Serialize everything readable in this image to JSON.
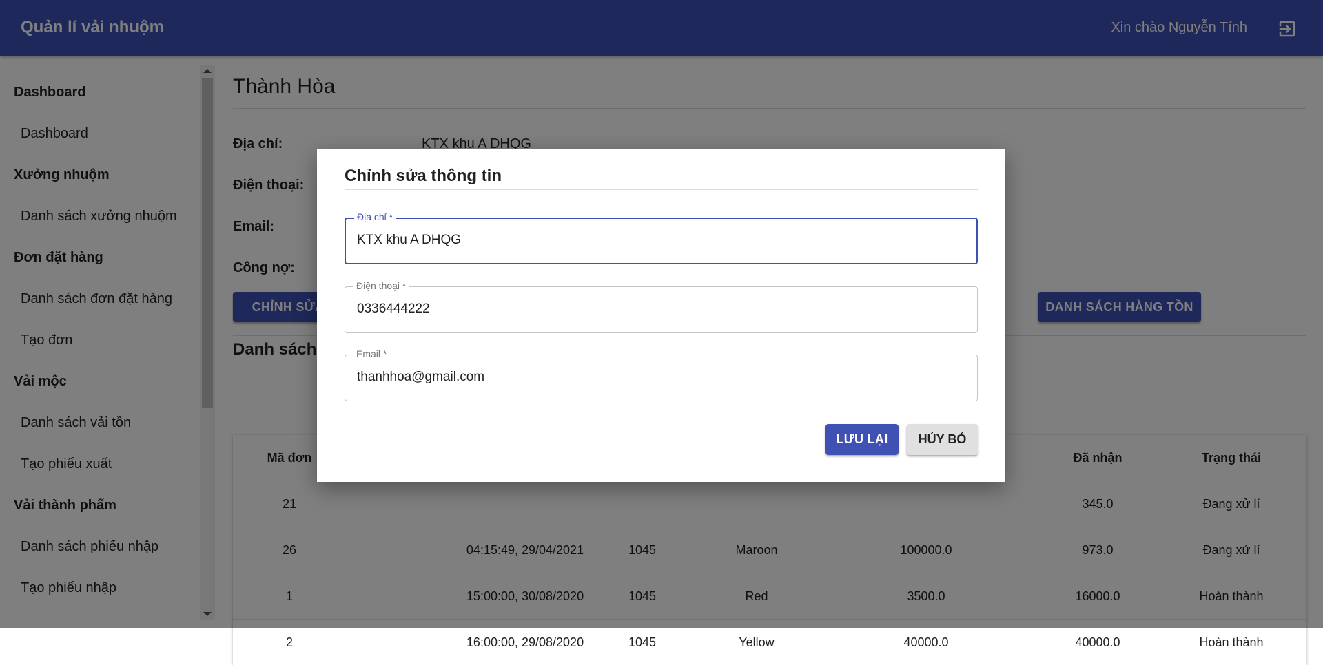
{
  "app": {
    "title": "Quản lí vải nhuộm",
    "greeting": "Xin chào Nguyễn Tính",
    "logout_icon": "logout-icon"
  },
  "sidebar": {
    "groups": [
      {
        "label": "Dashboard",
        "items": [
          "Dashboard"
        ]
      },
      {
        "label": "Xưởng nhuộm",
        "items": [
          "Danh sách xưởng nhuộm"
        ]
      },
      {
        "label": "Đơn đặt hàng",
        "items": [
          "Danh sách đơn đặt hàng",
          "Tạo đơn"
        ]
      },
      {
        "label": "Vải mộc",
        "items": [
          "Danh sách vải tồn",
          "Tạo phiếu xuất"
        ]
      },
      {
        "label": "Vải thành phẩm",
        "items": [
          "Danh sách phiếu nhập",
          "Tạo phiếu nhập"
        ]
      }
    ]
  },
  "main": {
    "title": "Thành Hòa",
    "info": [
      {
        "label": "Địa chỉ:",
        "value": "KTX khu A DHQG"
      },
      {
        "label": "Điện thoại:",
        "value": ""
      },
      {
        "label": "Email:",
        "value": ""
      },
      {
        "label": "Công nợ:",
        "value": ""
      }
    ],
    "edit_button": "CHỈNH SỬA",
    "stock_button": "DANH SÁCH HÀNG TỒN",
    "list_heading": "Danh sách",
    "table": {
      "headers": [
        "Mã đơn",
        "",
        "",
        "",
        "",
        "Đã nhận",
        "Trạng thái"
      ],
      "rows": [
        [
          "21",
          "",
          "",
          "",
          "",
          "345.0",
          "Đang xử lí"
        ],
        [
          "26",
          "04:15:49, 29/04/2021",
          "1045",
          "Maroon",
          "100000.0",
          "973.0",
          "Đang xử lí"
        ],
        [
          "1",
          "15:00:00, 30/08/2020",
          "1045",
          "Red",
          "3500.0",
          "16000.0",
          "Hoàn thành"
        ],
        [
          "2",
          "16:00:00, 29/08/2020",
          "1045",
          "Yellow",
          "40000.0",
          "40000.0",
          "Hoàn thành"
        ]
      ]
    }
  },
  "dialog": {
    "title": "Chỉnh sửa thông tin",
    "fields": [
      {
        "label": "Địa chỉ *",
        "value": "KTX khu A DHQG"
      },
      {
        "label": "Điện thoại *",
        "value": "0336444222"
      },
      {
        "label": "Email *",
        "value": "thanhhoa@gmail.com"
      }
    ],
    "save_label": "LƯU LẠI",
    "cancel_label": "HỦY BỎ"
  },
  "colors": {
    "primary": "#3f51b5",
    "overlay": "rgba(0,0,0,0.5)"
  }
}
